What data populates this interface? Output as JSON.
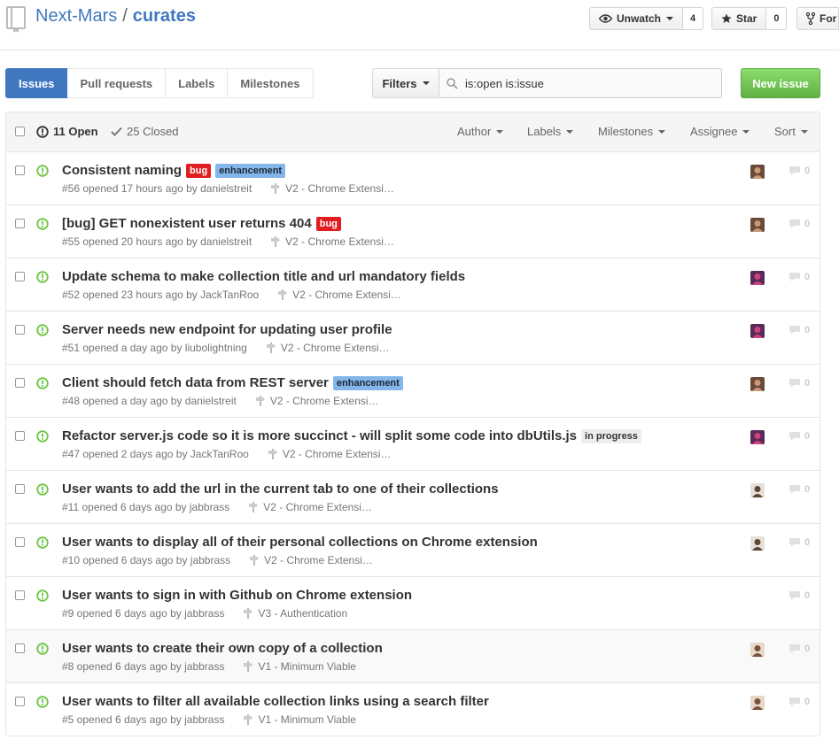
{
  "repo": {
    "owner": "Next-Mars",
    "separator": "/",
    "name": "curates",
    "unwatch_label": "Unwatch",
    "watch_count": "4",
    "star_label": "Star",
    "star_count": "0",
    "fork_label": "For"
  },
  "subnav": {
    "tabs": [
      "Issues",
      "Pull requests",
      "Labels",
      "Milestones"
    ],
    "selected": "Issues"
  },
  "filters": {
    "button_label": "Filters",
    "search_value": "is:open is:issue"
  },
  "new_issue_label": "New issue",
  "table_header": {
    "open_label": "11 Open",
    "closed_label": "25 Closed",
    "filters": [
      "Author",
      "Labels",
      "Milestones",
      "Assignee",
      "Sort"
    ]
  },
  "label_colors": {
    "bug": {
      "bg": "#e11d21",
      "fg": "#ffffff"
    },
    "enhancement": {
      "bg": "#84b6eb",
      "fg": "#1c2733"
    },
    "in progress": {
      "bg": "#ededed",
      "fg": "#333333"
    }
  },
  "colors": {
    "accent": "#4078c0",
    "open_green": "#6cc644",
    "new_issue": "#60b044"
  },
  "issues": [
    {
      "title": "Consistent naming",
      "labels": [
        "bug",
        "enhancement"
      ],
      "meta": "#56 opened 17 hours ago by danielstreit",
      "milestone": "V2 - Chrome Extensi…",
      "avatar": "danielstreit",
      "comments": "0"
    },
    {
      "title": "[bug] GET nonexistent user returns 404",
      "labels": [
        "bug"
      ],
      "meta": "#55 opened 20 hours ago by danielstreit",
      "milestone": "V2 - Chrome Extensi…",
      "avatar": "danielstreit",
      "comments": "0"
    },
    {
      "title": "Update schema to make collection title and url mandatory fields",
      "labels": [],
      "meta": "#52 opened 23 hours ago by JackTanRoo",
      "milestone": "V2 - Chrome Extensi…",
      "avatar": "JackTanRoo",
      "comments": "0"
    },
    {
      "title": "Server needs new endpoint for updating user profile",
      "labels": [],
      "meta": "#51 opened a day ago by liubolightning",
      "milestone": "V2 - Chrome Extensi…",
      "avatar": "JackTanRoo",
      "comments": "0"
    },
    {
      "title": "Client should fetch data from REST server",
      "labels": [
        "enhancement"
      ],
      "meta": "#48 opened a day ago by danielstreit",
      "milestone": "V2 - Chrome Extensi…",
      "avatar": "danielstreit",
      "comments": "0"
    },
    {
      "title": "Refactor server.js code so it is more succinct - will split some code into dbUtils.js",
      "labels": [
        "in progress"
      ],
      "meta": "#47 opened 2 days ago by JackTanRoo",
      "milestone": "V2 - Chrome Extensi…",
      "avatar": "JackTanRoo",
      "comments": "0"
    },
    {
      "title": "User wants to add the url in the current tab to one of their collections",
      "labels": [],
      "meta": "#11 opened 6 days ago by jabbrass",
      "milestone": "V2 - Chrome Extensi…",
      "avatar": "jabbrass",
      "comments": "0"
    },
    {
      "title": "User wants to display all of their personal collections on Chrome extension",
      "labels": [],
      "meta": "#10 opened 6 days ago by jabbrass",
      "milestone": "V2 - Chrome Extensi…",
      "avatar": "jabbrass",
      "comments": "0"
    },
    {
      "title": "User wants to sign in with Github on Chrome extension",
      "labels": [],
      "meta": "#9 opened 6 days ago by jabbrass",
      "milestone": "V3 - Authentication",
      "avatar": "",
      "comments": "0"
    },
    {
      "title": "User wants to create their own copy of a collection",
      "labels": [],
      "meta": "#8 opened 6 days ago by jabbrass",
      "milestone": "V1 - Minimum Viable",
      "avatar": "jabbrass2",
      "comments": "0"
    },
    {
      "title": "User wants to filter all available collection links using a search filter",
      "labels": [],
      "meta": "#5 opened 6 days ago by jabbrass",
      "milestone": "V1 - Minimum Viable",
      "avatar": "jabbrass2",
      "comments": "0"
    }
  ]
}
